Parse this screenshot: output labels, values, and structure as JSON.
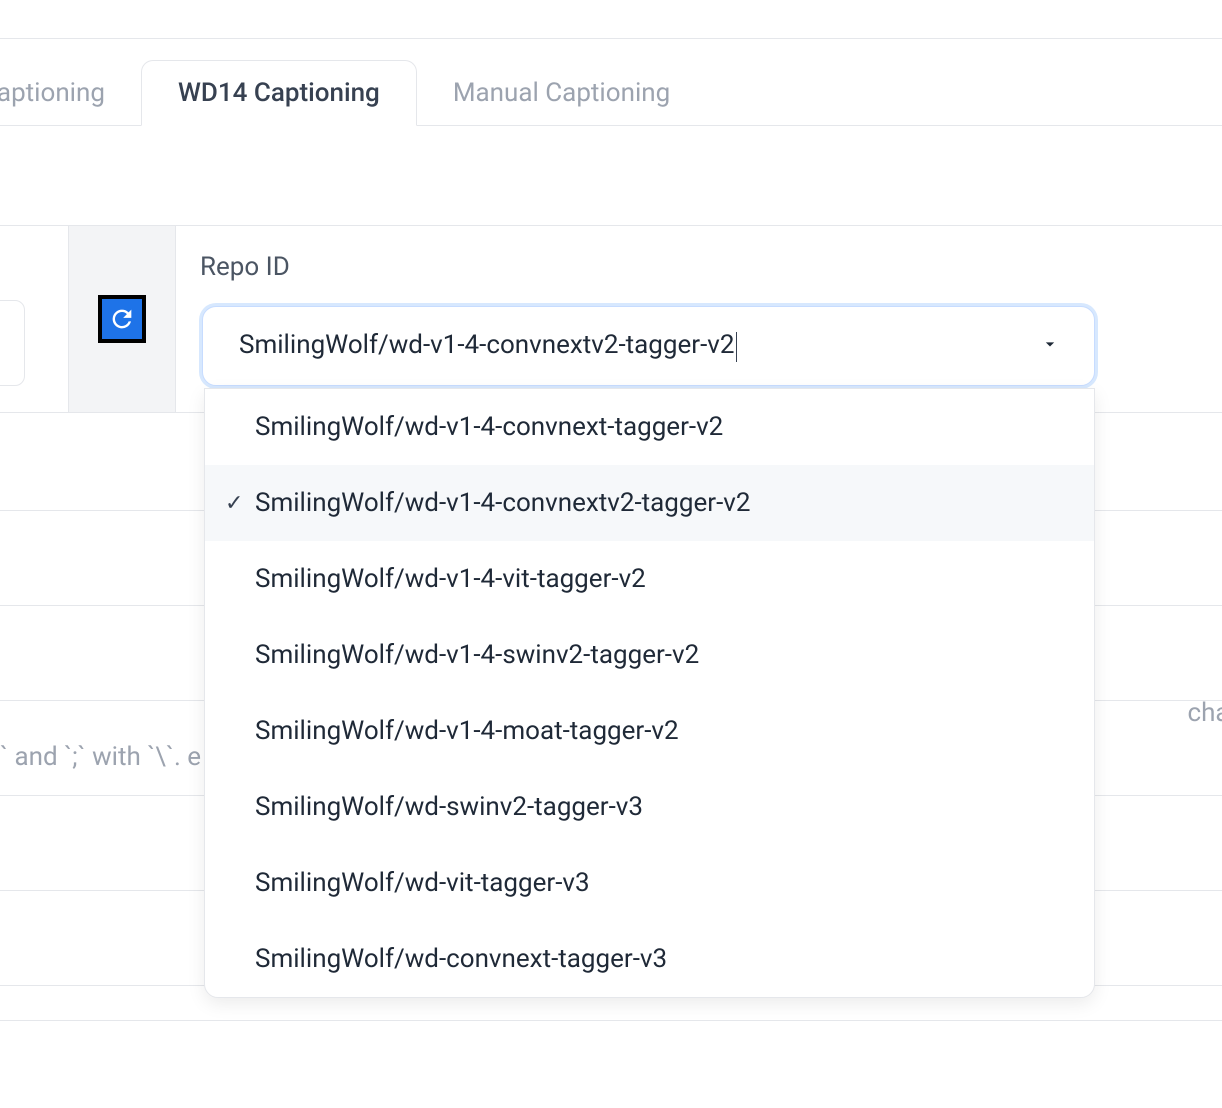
{
  "tabs": {
    "items": [
      {
        "label": "Captioning",
        "active": false
      },
      {
        "label": "WD14 Captioning",
        "active": true
      },
      {
        "label": "Manual Captioning",
        "active": false
      }
    ]
  },
  "repo": {
    "label": "Repo ID",
    "selected_value": "SmilingWolf/wd-v1-4-convnextv2-tagger-v2",
    "options": [
      "SmilingWolf/wd-v1-4-convnext-tagger-v2",
      "SmilingWolf/wd-v1-4-convnextv2-tagger-v2",
      "SmilingWolf/wd-v1-4-vit-tagger-v2",
      "SmilingWolf/wd-v1-4-swinv2-tagger-v2",
      "SmilingWolf/wd-v1-4-moat-tagger-v2",
      "SmilingWolf/wd-swinv2-tagger-v3",
      "SmilingWolf/wd-vit-tagger-v3",
      "SmilingWolf/wd-convnext-tagger-v3"
    ],
    "selected_index": 1
  },
  "background_text": {
    "right_fragment": "chara",
    "left_fragment": "` and `;` with `\\`. e"
  },
  "icons": {
    "refresh": "refresh-icon",
    "caret": "chevron-down-icon",
    "check": "✓"
  }
}
